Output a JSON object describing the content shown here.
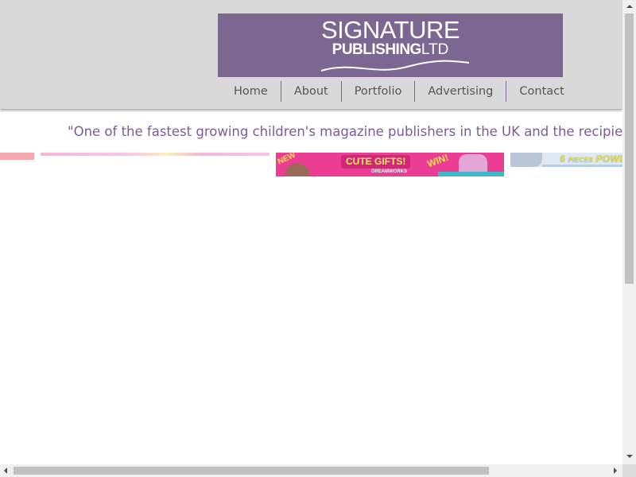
{
  "logo": {
    "line1": "SIGNATURE",
    "line2_bold": "PUBLISHING",
    "line2_light": "LTD",
    "background": "#7b6792"
  },
  "nav": {
    "items": [
      {
        "label": "Home"
      },
      {
        "label": "About"
      },
      {
        "label": "Portfolio"
      },
      {
        "label": "Advertising"
      },
      {
        "label": "Contact"
      }
    ],
    "divider_color": "#7b6792"
  },
  "tagline": "\"One of the fastest growing children's magazine publishers in the UK and the recipient of mu",
  "carousel": {
    "magazine": {
      "badge_new": "NEW",
      "headline": "CUTE GIFTS!",
      "brand": "DREAMWORKS",
      "badge_win": "WIN!"
    },
    "next_cover": {
      "count": "6",
      "pieces": "PIECES",
      "word": "POWE"
    }
  },
  "colors": {
    "header_bg": "#d9d9d9",
    "tagline": "#7b5b9a",
    "nav_text": "#555555"
  }
}
